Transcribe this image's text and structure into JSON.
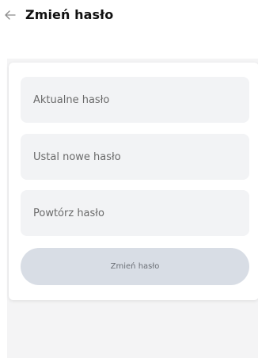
{
  "header": {
    "title": "Zmień hasło",
    "back_icon": "arrow-left-icon"
  },
  "form": {
    "current_password": {
      "value": "",
      "placeholder": "Aktualne hasło"
    },
    "new_password": {
      "value": "",
      "placeholder": "Ustal nowe hasło"
    },
    "repeat_password": {
      "value": "",
      "placeholder": "Powtórz hasło"
    },
    "submit_label": "Zmień hasło"
  },
  "colors": {
    "field_bg": "#f2f3f5",
    "button_bg": "#d8dde5",
    "page_bg": "#f4f4f5"
  }
}
